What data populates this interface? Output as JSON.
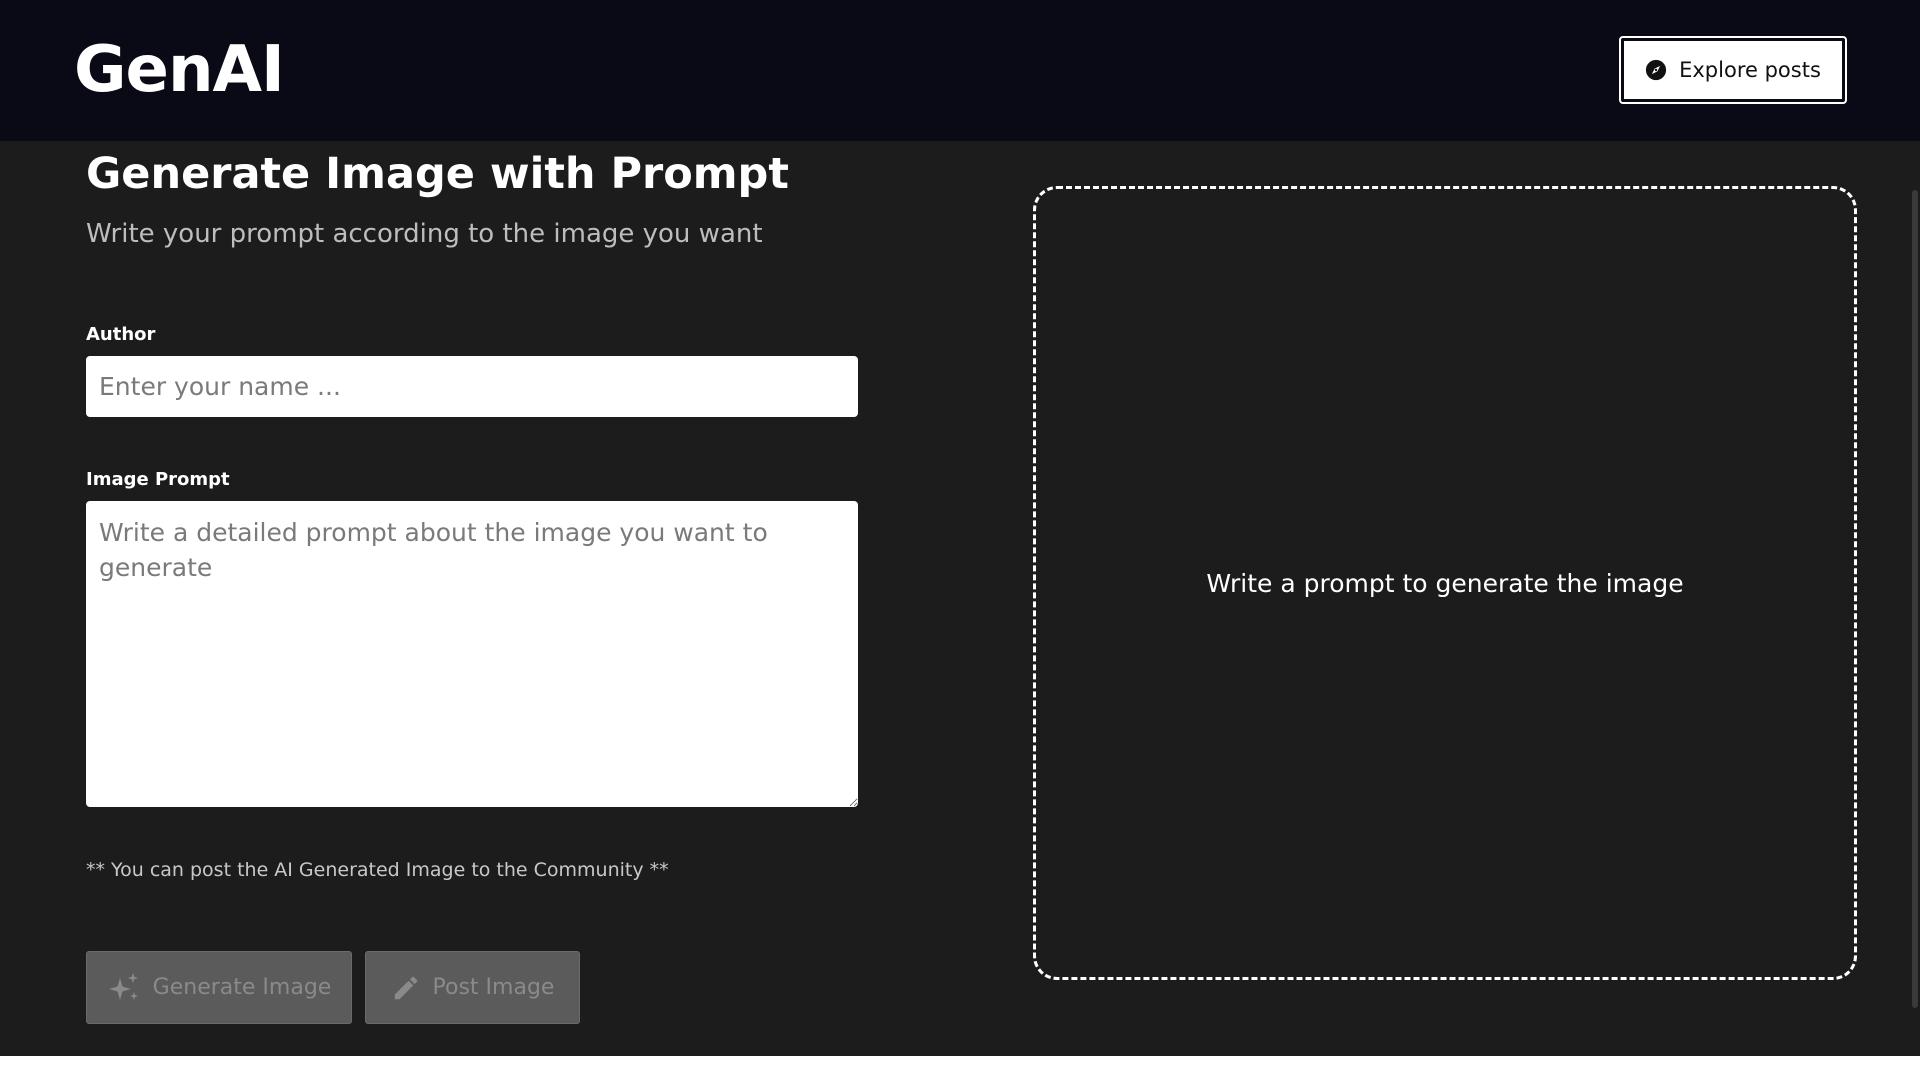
{
  "header": {
    "logo": "GenAI",
    "explore_label": "Explore posts",
    "explore_icon": "compass-icon"
  },
  "main": {
    "title": "Generate Image with Prompt",
    "subtitle": "Write your prompt according to the image you want",
    "author": {
      "label": "Author",
      "value": "",
      "placeholder": "Enter your name ..."
    },
    "prompt": {
      "label": "Image Prompt",
      "value": "",
      "placeholder": "Write a detailed prompt about the image you want to generate"
    },
    "note": "** You can post the AI Generated Image to the Community **",
    "generate_label": "Generate Image",
    "generate_icon": "sparkle-icon",
    "post_label": "Post Image",
    "post_icon": "pencil-icon"
  },
  "preview": {
    "text": "Write a prompt to generate the image"
  },
  "colors": {
    "background": "#1c1c1c",
    "header": "#0a0a17",
    "button_disabled": "#5b5b5b"
  }
}
